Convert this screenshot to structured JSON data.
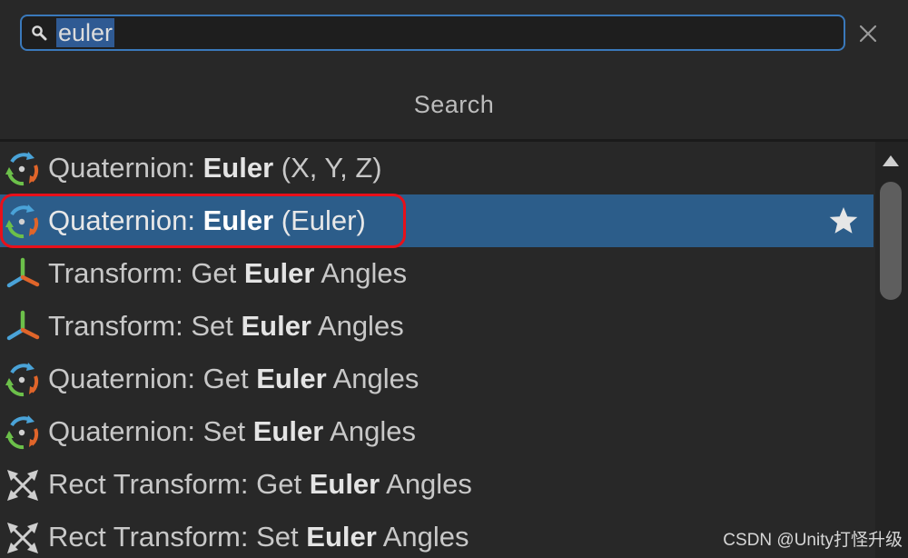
{
  "search": {
    "query": "euler",
    "clear_icon": "close-icon",
    "title": "Search"
  },
  "results": [
    {
      "prefix": "Quaternion: ",
      "match": "Euler",
      "suffix": " (X, Y, Z)",
      "icon": "quaternion-icon",
      "selected": false
    },
    {
      "prefix": "Quaternion: ",
      "match": "Euler",
      "suffix": " (Euler)",
      "icon": "quaternion-icon",
      "selected": true,
      "favorite_icon": "star-icon"
    },
    {
      "prefix": "Transform: Get ",
      "match": "Euler",
      "suffix": " Angles",
      "icon": "transform-icon",
      "selected": false
    },
    {
      "prefix": "Transform: Set ",
      "match": "Euler",
      "suffix": " Angles",
      "icon": "transform-icon",
      "selected": false
    },
    {
      "prefix": "Quaternion: Get ",
      "match": "Euler",
      "suffix": " Angles",
      "icon": "quaternion-icon",
      "selected": false
    },
    {
      "prefix": "Quaternion: Set ",
      "match": "Euler",
      "suffix": " Angles",
      "icon": "quaternion-icon",
      "selected": false
    },
    {
      "prefix": "Rect Transform: Get ",
      "match": "Euler",
      "suffix": " Angles",
      "icon": "rect-transform-icon",
      "selected": false
    },
    {
      "prefix": "Rect Transform: Set ",
      "match": "Euler",
      "suffix": " Angles",
      "icon": "rect-transform-icon",
      "selected": false
    }
  ],
  "colors": {
    "background": "#282828",
    "selected_row": "#2c5d8a",
    "search_border": "#3a79bb",
    "annotation_ring": "#e8101a",
    "quaternion_blue": "#4aa3d8",
    "quaternion_orange": "#e0652a",
    "quaternion_green": "#6cc04a"
  },
  "watermark": "CSDN @Unity打怪升级"
}
